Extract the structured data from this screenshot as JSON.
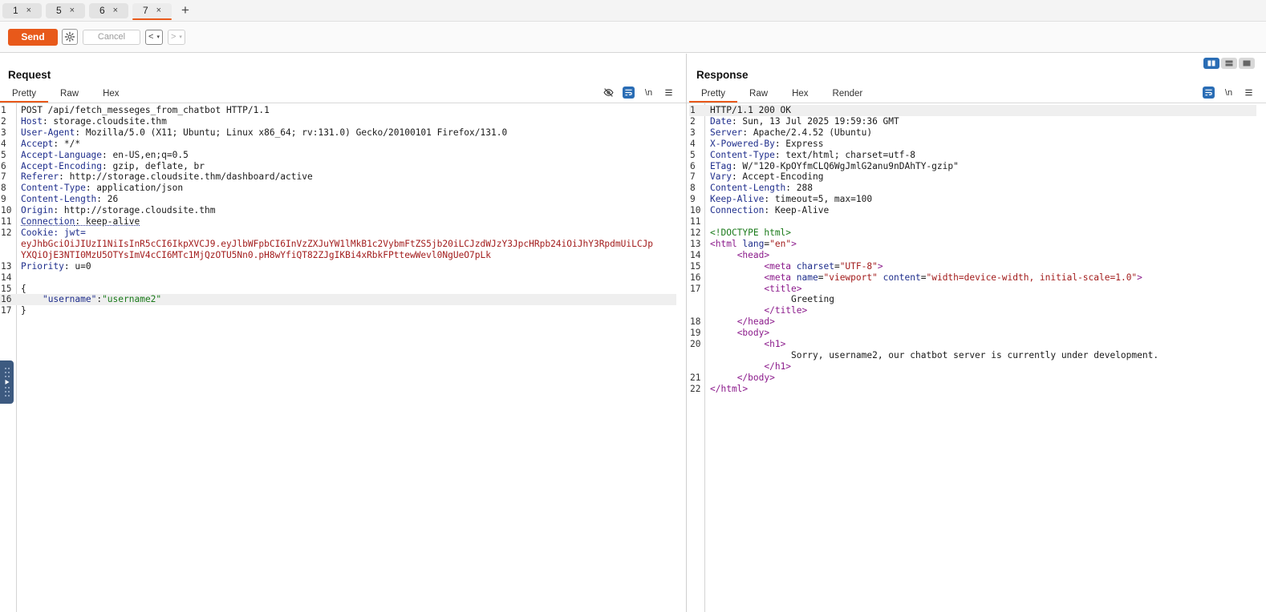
{
  "tabs": [
    {
      "label": "1",
      "active": false
    },
    {
      "label": "5",
      "active": false
    },
    {
      "label": "6",
      "active": false
    },
    {
      "label": "7",
      "active": true
    }
  ],
  "tab_add_label": "+",
  "tab_close_glyph": "×",
  "toolbar": {
    "send_label": "Send",
    "cancel_label": "Cancel",
    "back_label": "<",
    "forward_label": ">",
    "dropdown_glyph": "▾"
  },
  "request": {
    "title": "Request",
    "tabs": [
      "Pretty",
      "Raw",
      "Hex"
    ],
    "active_tab": "Pretty",
    "newline_toggle": "\\n",
    "lines": {
      "l1": "POST /api/fetch_messeges_from_chatbot HTTP/1.1",
      "l2k": "Host",
      "l2v": ": storage.cloudsite.thm",
      "l3k": "User-Agent",
      "l3v": ": Mozilla/5.0 (X11; Ubuntu; Linux x86_64; rv:131.0) Gecko/20100101 Firefox/131.0",
      "l4k": "Accept",
      "l4v": ": */*",
      "l5k": "Accept-Language",
      "l5v": ": en-US,en;q=0.5",
      "l6k": "Accept-Encoding",
      "l6v": ": gzip, deflate, br",
      "l7k": "Referer",
      "l7v": ": http://storage.cloudsite.thm/dashboard/active",
      "l8k": "Content-Type",
      "l8v": ": application/json",
      "l9k": "Content-Length",
      "l9v": ": 26",
      "l10k": "Origin",
      "l10v": ": http://storage.cloudsite.thm",
      "l11k": "Connection",
      "l11v": ": keep-alive",
      "l12k": "Cookie",
      "l12v": ": jwt=",
      "l12a": "eyJhbGciOiJIUzI1NiIsInR5cCI6IkpXVCJ9.eyJlbWFpbCI6InVzZXJuYW1lMkB1c2VybmFtZS5jb20iLCJzdWJzY3JpcHRpb24iOiJhY3RpdmUiLCJp",
      "l12b": "YXQiOjE3NTI0MzU5OTYsImV4cCI6MTc1MjQzOTU5Nn0.pH8wYfiQT82ZJgIKBi4xRbkFPttewWevl0NgUeO7pLk",
      "l13k": "Priority",
      "l13v": ": u=0",
      "l15": "{",
      "l16k": "\"username\"",
      "l16sep": ":",
      "l16v": "\"username2\"",
      "l17": "}"
    }
  },
  "response": {
    "title": "Response",
    "tabs": [
      "Pretty",
      "Raw",
      "Hex",
      "Render"
    ],
    "active_tab": "Pretty",
    "newline_toggle": "\\n",
    "lines": {
      "l1": "HTTP/1.1 200 OK",
      "l2k": "Date",
      "l2v": ": Sun, 13 Jul 2025 19:59:36 GMT",
      "l3k": "Server",
      "l3v": ": Apache/2.4.52 (Ubuntu)",
      "l4k": "X-Powered-By",
      "l4v": ": Express",
      "l5k": "Content-Type",
      "l5v": ": text/html; charset=utf-8",
      "l6k": "ETag",
      "l6v": ": W/\"120-KpOYfmCLQ6WgJmlG2anu9nDAhTY-gzip\"",
      "l7k": "Vary",
      "l7v": ": Accept-Encoding",
      "l8k": "Content-Length",
      "l8v": ": 288",
      "l9k": "Keep-Alive",
      "l9v": ": timeout=5, max=100",
      "l10k": "Connection",
      "l10v": ": Keep-Alive",
      "l12": "<!DOCTYPE html>",
      "l13a": "<html",
      "l13b": " lang",
      "l13c": "=",
      "l13d": "\"en\"",
      "l13e": ">",
      "l14": "<head>",
      "l15a": "<meta",
      "l15b": " charset",
      "l15c": "=",
      "l15d": "\"UTF-8\"",
      "l15e": ">",
      "l16a": "<meta",
      "l16b": " name",
      "l16c": "=",
      "l16d": "\"viewport\"",
      "l16f": " content",
      "l16g": "=",
      "l16h": "\"width=device-width, initial-scale=1.0\"",
      "l16e": ">",
      "l17": "<title>",
      "l17b": "Greeting",
      "l17c": "</title>",
      "l18": "</head>",
      "l19": "<body>",
      "l20": "<h1>",
      "l20b": "Sorry, username2, our chatbot server is currently under development.",
      "l20c": "</h1>",
      "l21": "</body>",
      "l22": "</html>"
    }
  },
  "colors": {
    "accent": "#e8591a",
    "header_key": "#1f2e8c",
    "cookie_value": "#a21c1c",
    "json_string": "#1a7a1a",
    "html_tag": "#8b1a8b",
    "toggle_blue": "#2a6db5"
  }
}
